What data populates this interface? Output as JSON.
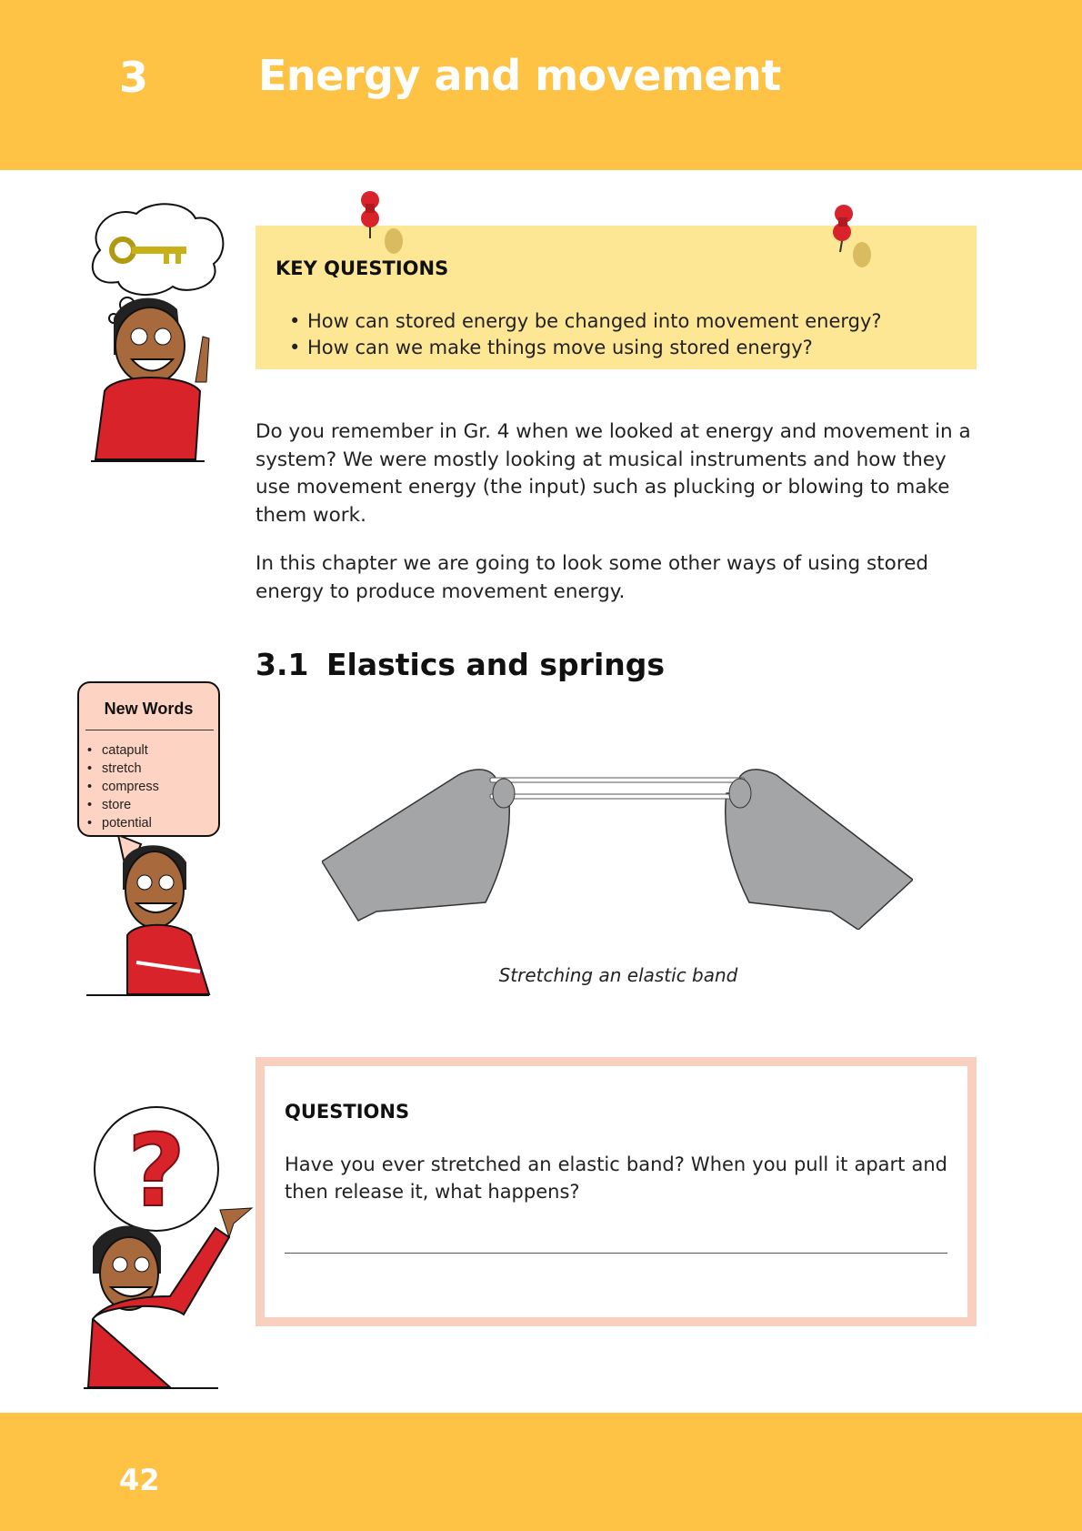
{
  "header": {
    "chapter_number": "3",
    "chapter_title": "Energy and movement",
    "color": "#fec345"
  },
  "key_questions": {
    "heading": "KEY QUESTIONS",
    "items": [
      "How can stored energy be changed into movement energy?",
      "How can we make things move using stored energy?"
    ],
    "color": "#fde694"
  },
  "intro": {
    "paragraphs": [
      "Do you remember in Gr. 4 when we looked at energy and movement in a system? We were mostly looking at musical instruments and how they use movement energy (the input) such as plucking or blowing to make them work.",
      "In this chapter we are going to look some other ways of using stored energy to produce movement energy."
    ]
  },
  "section": {
    "number": "3.1",
    "title": "Elastics and springs"
  },
  "new_words": {
    "title": "New Words",
    "items": [
      "catapult",
      "stretch",
      "compress",
      "store",
      "potential"
    ],
    "color": "#fdd3c4"
  },
  "figure": {
    "caption": "Stretching an elastic band"
  },
  "questions": {
    "heading": "QUESTIONS",
    "text": "Have you ever stretched an elastic band?  When you pull it apart and then release it, what happens?",
    "answer": "",
    "border_color": "#f9d0c0"
  },
  "footer": {
    "page_number": "42"
  }
}
